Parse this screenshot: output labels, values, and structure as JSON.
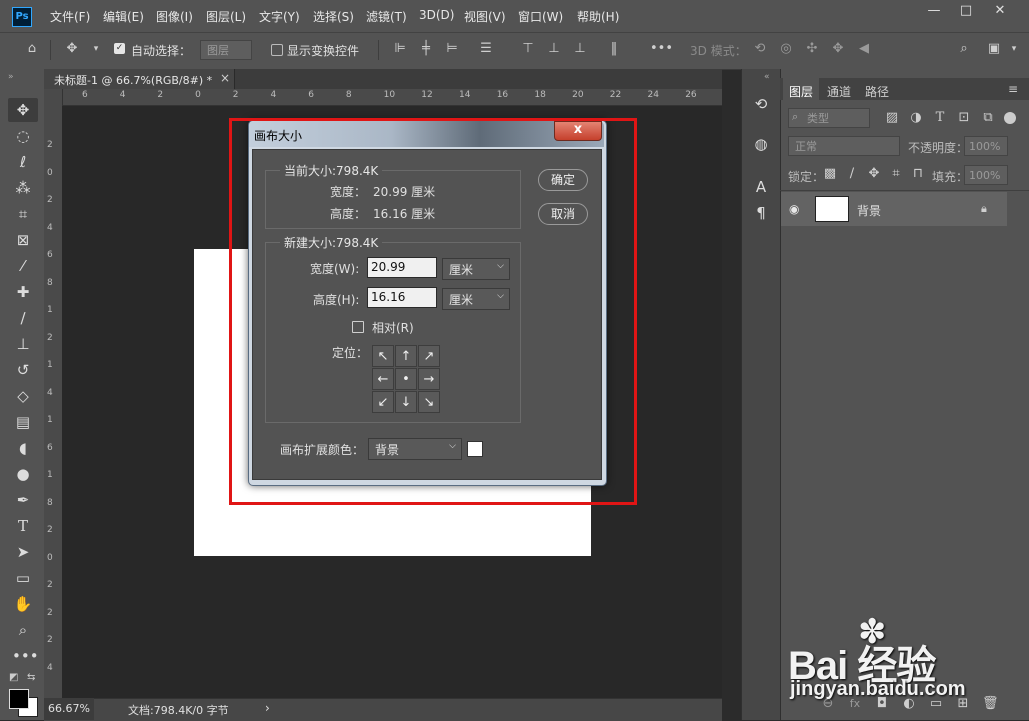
{
  "app": {
    "logo": "Ps"
  },
  "menu": [
    "文件(F)",
    "编辑(E)",
    "图像(I)",
    "图层(L)",
    "文字(Y)",
    "选择(S)",
    "滤镜(T)",
    "3D(D)",
    "视图(V)",
    "窗口(W)",
    "帮助(H)"
  ],
  "window_controls": {
    "minimize": "—",
    "maximize": "□",
    "close": "✕"
  },
  "options": {
    "auto_select_label": "自动选择：",
    "auto_select_target": "图层",
    "show_transform_label": "显示变换控件",
    "mode_3d_label": "3D 模式："
  },
  "document_tab": {
    "title": "未标题-1 @ 66.7%(RGB/8#) *",
    "close": "×"
  },
  "ruler_top_ticks": [
    "6",
    "4",
    "2",
    "0",
    "2",
    "4",
    "6",
    "8",
    "10",
    "12",
    "14",
    "16",
    "18",
    "20",
    "22",
    "24",
    "26"
  ],
  "ruler_left_ticks": [
    "2",
    "0",
    "2",
    "4",
    "6",
    "8",
    "1",
    "2",
    "1",
    "4",
    "1",
    "6",
    "1",
    "8",
    "2",
    "0",
    "2",
    "2",
    "2",
    "4"
  ],
  "status": {
    "zoom": "66.67%",
    "doc_info": "文档:798.4K/0 字节",
    "arrow": "›"
  },
  "panel": {
    "tabs": [
      "图层",
      "通道",
      "路径"
    ],
    "kind_filter": "类型",
    "blend_mode": "正常",
    "opacity_label": "不透明度：",
    "opacity_value": "100%",
    "lock_label": "锁定：",
    "fill_label": "填充：",
    "fill_value": "100%",
    "layer_name": "背景"
  },
  "dialog": {
    "title": "画布大小",
    "close_label": "x",
    "current_size_title": "当前大小:798.4K",
    "current_width_label": "宽度：",
    "current_width_value": "20.99 厘米",
    "current_height_label": "高度：",
    "current_height_value": "16.16 厘米",
    "new_size_title": "新建大小:798.4K",
    "width_label": "宽度(W):",
    "width_value": "20.99",
    "height_label": "高度(H):",
    "height_value": "16.16",
    "unit": "厘米",
    "relative_label": "相对(R)",
    "anchor_label": "定位：",
    "anchor_glyphs": [
      "↖",
      "↑",
      "↗",
      "←",
      "•",
      "→",
      "↙",
      "↓",
      "↘"
    ],
    "extension_color_label": "画布扩展颜色：",
    "extension_color_value": "背景",
    "ok": "确定",
    "cancel": "取消"
  },
  "watermark": {
    "logo": "Bai 经验",
    "url": "jingyan.baidu.com"
  },
  "colors": {
    "highlight": "#e01515",
    "canvas": "#ffffff",
    "app_bg": "#535353"
  }
}
